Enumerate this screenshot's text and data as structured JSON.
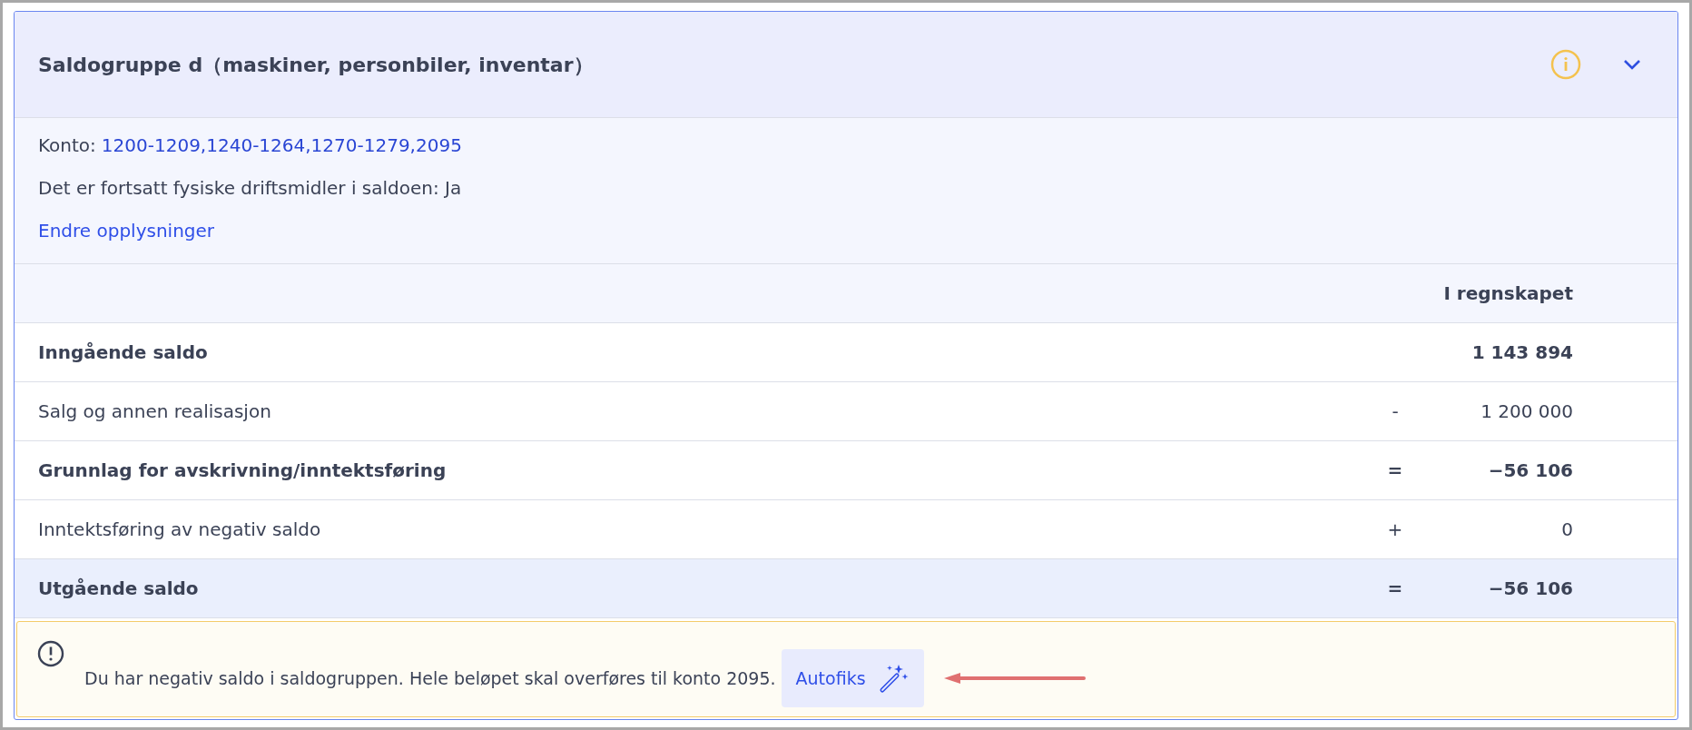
{
  "panel": {
    "title": "Saldogruppe d（maskiner, personbiler, inventar）",
    "expanded": true
  },
  "info": {
    "account_label": "Konto:",
    "accounts": "1200-1209,1240-1264,1270-1279,2095",
    "assets_line": "Det er fortsatt fysiske driftsmidler i saldoen: Ja",
    "edit_link": "Endre opplysninger"
  },
  "table": {
    "column_header": "I regnskapet",
    "rows": [
      {
        "label": "Inngående saldo",
        "operator": "",
        "value": "1 143 894",
        "bold": true,
        "highlighted": false
      },
      {
        "label": "Salg og annen realisasjon",
        "operator": "-",
        "value": "1 200 000",
        "bold": false,
        "highlighted": false
      },
      {
        "label": "Grunnlag for avskrivning/inntektsføring",
        "operator": "=",
        "value": "−56 106",
        "bold": true,
        "highlighted": false
      },
      {
        "label": "Inntektsføring av negativ saldo",
        "operator": "+",
        "value": "0",
        "bold": false,
        "highlighted": false
      },
      {
        "label": "Utgående saldo",
        "operator": "=",
        "value": "−56 106",
        "bold": true,
        "highlighted": true
      }
    ]
  },
  "warning": {
    "message": "Du har negativ saldo i saldogruppen. Hele beløpet skal overføres til konto 2095.",
    "action": "Autofiks"
  }
}
